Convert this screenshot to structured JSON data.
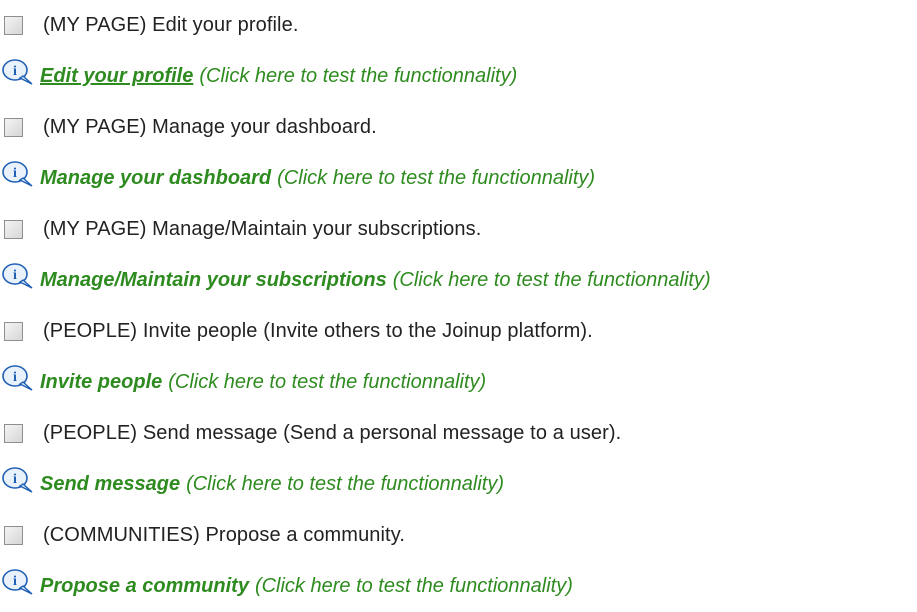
{
  "items": [
    {
      "task": "(MY PAGE) Edit your profile.",
      "link": "Edit your profile",
      "hint": "(Click here to test the functionnality)",
      "underlined": true
    },
    {
      "task": "(MY PAGE) Manage your dashboard.",
      "link": "Manage your dashboard",
      "hint": "(Click here to test the functionnality)",
      "underlined": false
    },
    {
      "task": "(MY PAGE) Manage/Maintain your subscriptions.",
      "link": "Manage/Maintain your subscriptions",
      "hint": "(Click here to test the functionnality)",
      "underlined": false
    },
    {
      "task": "(PEOPLE) Invite people (Invite others to the Joinup platform).",
      "link": "Invite people",
      "hint": "(Click here to test the functionnality)",
      "underlined": false
    },
    {
      "task": "(PEOPLE) Send message (Send a personal message to a user).",
      "link": "Send message",
      "hint": "(Click here to test the functionnality)",
      "underlined": false
    },
    {
      "task": "(COMMUNITIES) Propose a community.",
      "link": "Propose a community",
      "hint": "(Click here to test the functionnality)",
      "underlined": false
    }
  ],
  "icons": {
    "checkbox": "checkbox-icon",
    "info": "info-icon"
  },
  "colors": {
    "link": "#2e8b1f",
    "text": "#222222",
    "info_icon": "#1e5fb4"
  }
}
